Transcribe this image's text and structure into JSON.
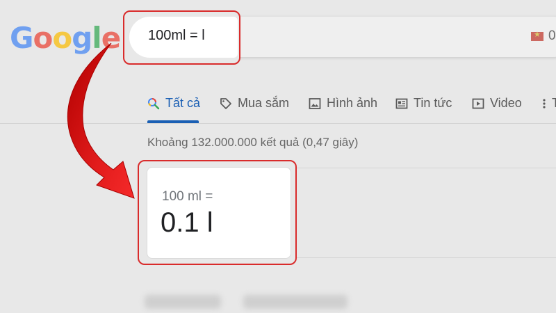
{
  "logo": {
    "letters": [
      "G",
      "o",
      "o",
      "g",
      "l",
      "e"
    ],
    "colors": [
      "#4285f4",
      "#ea4335",
      "#fbbc05",
      "#4285f4",
      "#34a853",
      "#ea4335"
    ]
  },
  "search": {
    "query": "100ml = l",
    "result_count_badge": "0"
  },
  "tabs": [
    {
      "label": "Tất cả",
      "icon": "search-icon",
      "active": true
    },
    {
      "label": "Mua sắm",
      "icon": "tag-icon",
      "active": false
    },
    {
      "label": "Hình ảnh",
      "icon": "image-icon",
      "active": false
    },
    {
      "label": "Tin tức",
      "icon": "news-icon",
      "active": false
    },
    {
      "label": "Video",
      "icon": "play-icon",
      "active": false
    },
    {
      "label": "T",
      "icon": "more-vert-icon",
      "active": false
    }
  ],
  "results": {
    "stats": "Khoảng 132.000.000 kết quả (0,47 giây)"
  },
  "converter": {
    "from": "100 ml =",
    "to": "0.1 l"
  },
  "colors": {
    "highlight": "#d92b2b",
    "arrow": "#e01515",
    "active_tab": "#1a5fb4"
  }
}
